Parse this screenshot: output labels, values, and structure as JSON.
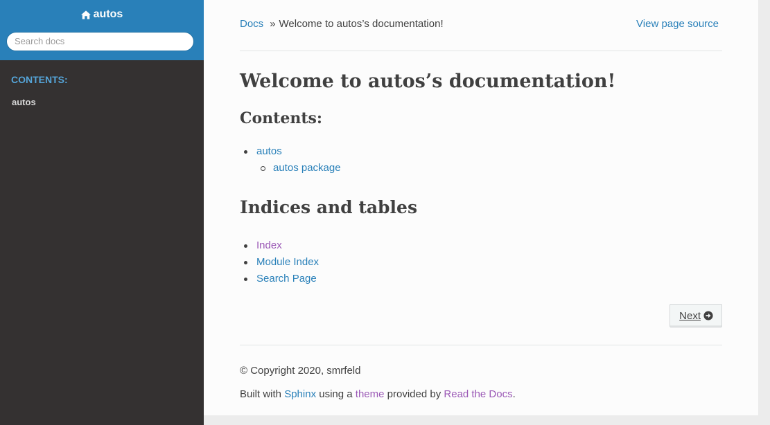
{
  "sidebar": {
    "project_name": "autos",
    "search_placeholder": "Search docs",
    "caption": "CONTENTS:",
    "nav_items": [
      {
        "label": "autos"
      }
    ],
    "colors": {
      "top_bg": "#2980b9",
      "bg": "#343131",
      "caption": "#55a5d9"
    }
  },
  "breadcrumbs": {
    "home_label": "Docs",
    "separator": "»",
    "current": "Welcome to autos’s documentation!",
    "view_source_label": "View page source"
  },
  "main": {
    "title": "Welcome to autos’s documentation!",
    "contents_heading": "Contents:",
    "toc": [
      {
        "label": "autos",
        "children": [
          {
            "label": "autos package"
          }
        ]
      }
    ],
    "indices_heading": "Indices and tables",
    "indices": [
      {
        "label": "Index"
      },
      {
        "label": "Module Index"
      },
      {
        "label": "Search Page"
      }
    ]
  },
  "pager": {
    "next_label": "Next",
    "icon": "arrow-circle-right-icon"
  },
  "footer": {
    "copyright": "© Copyright 2020, smrfeld",
    "built_prefix": "Built with ",
    "sphinx_label": "Sphinx",
    "using_text": " using a ",
    "theme_label": "theme",
    "provided_text": " provided by ",
    "rtd_label": "Read the Docs",
    "end_text": "."
  },
  "colors": {
    "link": "#2980b9",
    "visited_link": "#9b59b6",
    "text": "#404040",
    "page_bg": "#fcfcfc"
  }
}
